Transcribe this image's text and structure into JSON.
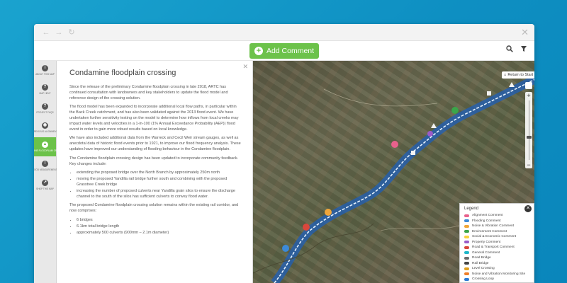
{
  "toolbar": {
    "add_comment_label": "Add Comment"
  },
  "side_nav": [
    {
      "label": "ABOUT THIS MAP",
      "icon": "info-icon",
      "active": false
    },
    {
      "label": "MAP HELP",
      "icon": "help-icon",
      "active": false
    },
    {
      "label": "PROJECT FAQS",
      "icon": "question-icon",
      "active": false
    },
    {
      "label": "PREVIOUS ALIGNMENT",
      "icon": "eye-icon",
      "active": false
    },
    {
      "label": "CONDAMINE FLOODPLAIN CROSSING",
      "icon": "water-drop-icon",
      "active": true
    },
    {
      "label": "FLOOD MEASUREMENTS",
      "icon": "warning-icon",
      "active": false
    },
    {
      "label": "SHOP THIS MAP",
      "icon": "share-icon",
      "active": false
    }
  ],
  "panel": {
    "title": "Condamine floodplain crossing",
    "paragraphs": [
      "Since the release of the preliminary Condamine floodplain crossing in late 2018, ARTC has continued consultation with landowners and key stakeholders to update the flood model and reference design of the crossing solution.",
      "The flood model has been expanded to incorporate additional local flow paths, in particular within the Back Creek catchment, and has also been validated against the 2013 flood event. We have undertaken further sensitivity testing on the model to determine how inflows from local creeks may impact water levels and velocities in a 1-in-100 (1% Annual Exceedance Probability (AEP)) flood event in order to gain more robust results based on local knowledge.",
      "We have also included additional data from the Warreck and Cecil Weir stream gauges, as well as anecdotal data of historic flood events prior to 1921, to improve our flood frequency analysis. These updates have improved our understanding of flooding behaviour in the Condamine floodplain.",
      "The Condamine floodplain crossing design has been updated to incorporate community feedback. Key changes include:"
    ],
    "bullets_1": [
      "extending the proposed bridge over the North Branch by approximately 250m north",
      "moving the proposed Yandilla rail bridge further south and combining with the proposed Grasstree Creek bridge",
      "increasing the number of proposed culverts near Yandilla grain silos to ensure the discharge channel to the south of the silos has sufficient culverts to convey flood water."
    ],
    "paragraph_after": "The proposed Condamine floodplain crossing solution remains within the existing rail corridor, and now comprises:",
    "bullets_2": [
      "6 bridges",
      "6.1km total bridge length",
      "approximately 500 culverts (900mm – 2.1m diameter)"
    ]
  },
  "map": {
    "return_label": "Return to Start",
    "corridor_color": "#1f5fb8",
    "track_color": "#e9f4ff"
  },
  "legend": {
    "title": "Legend",
    "items": [
      {
        "label": "Alignment Comment",
        "color": "#e8618c"
      },
      {
        "label": "Flooding Comment",
        "color": "#3c8ad8"
      },
      {
        "label": "Noise & Vibration Comment",
        "color": "#f0a63a"
      },
      {
        "label": "Environment Comment",
        "color": "#3aa64a"
      },
      {
        "label": "Social & Economic Comment",
        "color": "#f6d23c"
      },
      {
        "label": "Property Comment",
        "color": "#9a5bc9"
      },
      {
        "label": "Road & Transport Comment",
        "color": "#d9473c"
      },
      {
        "label": "General Comment",
        "color": "#1fb7c9"
      },
      {
        "label": "Road Bridge",
        "color": "#6b6b6b"
      },
      {
        "label": "Rail Bridge",
        "color": "#444444"
      },
      {
        "label": "Level Crossing",
        "color": "#e0a020"
      },
      {
        "label": "Noise and Vibration Monitoring Site",
        "color": "#ef7f2a"
      },
      {
        "label": "Crossing Loop",
        "color": "#2c7bd6"
      }
    ]
  }
}
